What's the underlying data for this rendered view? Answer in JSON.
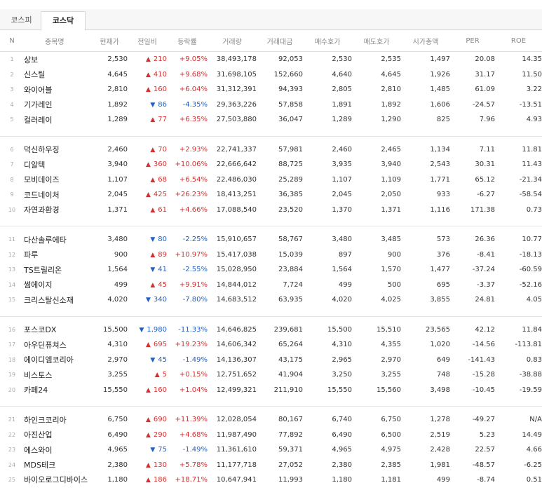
{
  "tabs": [
    {
      "label": "코스피",
      "active": false
    },
    {
      "label": "코스닥",
      "active": true
    }
  ],
  "columns": [
    "N",
    "종목명",
    "현재가",
    "전일비",
    "등락률",
    "거래량",
    "거래대금",
    "매수호가",
    "매도호가",
    "시가총액",
    "PER",
    "ROE"
  ],
  "colors": {
    "up": "#d32f2f",
    "down": "#1e5fc7"
  },
  "rows": [
    {
      "n": "1",
      "name": "상보",
      "price": "2,530",
      "dir": "up",
      "chg": "210",
      "rate": "+9.05%",
      "vol": "38,493,178",
      "amt": "92,053",
      "bid": "2,530",
      "ask": "2,535",
      "cap": "1,497",
      "per": "20.08",
      "roe": "14.35"
    },
    {
      "n": "2",
      "name": "신스틸",
      "price": "4,645",
      "dir": "up",
      "chg": "410",
      "rate": "+9.68%",
      "vol": "31,698,105",
      "amt": "152,660",
      "bid": "4,640",
      "ask": "4,645",
      "cap": "1,926",
      "per": "31.17",
      "roe": "11.50"
    },
    {
      "n": "3",
      "name": "와이어블",
      "price": "2,810",
      "dir": "up",
      "chg": "160",
      "rate": "+6.04%",
      "vol": "31,312,391",
      "amt": "94,393",
      "bid": "2,805",
      "ask": "2,810",
      "cap": "1,485",
      "per": "61.09",
      "roe": "3.22"
    },
    {
      "n": "4",
      "name": "기가레인",
      "price": "1,892",
      "dir": "down",
      "chg": "86",
      "rate": "-4.35%",
      "vol": "29,363,226",
      "amt": "57,858",
      "bid": "1,891",
      "ask": "1,892",
      "cap": "1,606",
      "per": "-24.57",
      "roe": "-13.51"
    },
    {
      "n": "5",
      "name": "컬러레이",
      "price": "1,289",
      "dir": "up",
      "chg": "77",
      "rate": "+6.35%",
      "vol": "27,503,880",
      "amt": "36,047",
      "bid": "1,289",
      "ask": "1,290",
      "cap": "825",
      "per": "7.96",
      "roe": "4.93"
    },
    {
      "n": "6",
      "name": "덕신하우징",
      "price": "2,460",
      "dir": "up",
      "chg": "70",
      "rate": "+2.93%",
      "vol": "22,741,337",
      "amt": "57,981",
      "bid": "2,460",
      "ask": "2,465",
      "cap": "1,134",
      "per": "7.11",
      "roe": "11.81"
    },
    {
      "n": "7",
      "name": "디알텍",
      "price": "3,940",
      "dir": "up",
      "chg": "360",
      "rate": "+10.06%",
      "vol": "22,666,642",
      "amt": "88,725",
      "bid": "3,935",
      "ask": "3,940",
      "cap": "2,543",
      "per": "30.31",
      "roe": "11.43"
    },
    {
      "n": "8",
      "name": "모비데이즈",
      "price": "1,107",
      "dir": "up",
      "chg": "68",
      "rate": "+6.54%",
      "vol": "22,486,030",
      "amt": "25,289",
      "bid": "1,107",
      "ask": "1,109",
      "cap": "1,771",
      "per": "65.12",
      "roe": "-21.34"
    },
    {
      "n": "9",
      "name": "코드네이처",
      "price": "2,045",
      "dir": "up",
      "chg": "425",
      "rate": "+26.23%",
      "vol": "18,413,251",
      "amt": "36,385",
      "bid": "2,045",
      "ask": "2,050",
      "cap": "933",
      "per": "-6.27",
      "roe": "-58.54"
    },
    {
      "n": "10",
      "name": "자연과환경",
      "price": "1,371",
      "dir": "up",
      "chg": "61",
      "rate": "+4.66%",
      "vol": "17,088,540",
      "amt": "23,520",
      "bid": "1,370",
      "ask": "1,371",
      "cap": "1,116",
      "per": "171.38",
      "roe": "0.73"
    },
    {
      "n": "11",
      "name": "다산솔루에타",
      "price": "3,480",
      "dir": "down",
      "chg": "80",
      "rate": "-2.25%",
      "vol": "15,910,657",
      "amt": "58,767",
      "bid": "3,480",
      "ask": "3,485",
      "cap": "573",
      "per": "26.36",
      "roe": "10.77"
    },
    {
      "n": "12",
      "name": "파루",
      "price": "900",
      "dir": "up",
      "chg": "89",
      "rate": "+10.97%",
      "vol": "15,417,038",
      "amt": "15,039",
      "bid": "897",
      "ask": "900",
      "cap": "376",
      "per": "-8.41",
      "roe": "-18.13"
    },
    {
      "n": "13",
      "name": "TS트릴리온",
      "price": "1,564",
      "dir": "down",
      "chg": "41",
      "rate": "-2.55%",
      "vol": "15,028,950",
      "amt": "23,884",
      "bid": "1,564",
      "ask": "1,570",
      "cap": "1,477",
      "per": "-37.24",
      "roe": "-60.59"
    },
    {
      "n": "14",
      "name": "썸에이지",
      "price": "499",
      "dir": "up",
      "chg": "45",
      "rate": "+9.91%",
      "vol": "14,844,012",
      "amt": "7,724",
      "bid": "499",
      "ask": "500",
      "cap": "695",
      "per": "-3.37",
      "roe": "-52.16"
    },
    {
      "n": "15",
      "name": "크리스탈신소재",
      "price": "4,020",
      "dir": "down",
      "chg": "340",
      "rate": "-7.80%",
      "vol": "14,683,512",
      "amt": "63,935",
      "bid": "4,020",
      "ask": "4,025",
      "cap": "3,855",
      "per": "24.81",
      "roe": "4.05"
    },
    {
      "n": "16",
      "name": "포스코DX",
      "price": "15,500",
      "dir": "down",
      "chg": "1,980",
      "rate": "-11.33%",
      "vol": "14,646,825",
      "amt": "239,681",
      "bid": "15,500",
      "ask": "15,510",
      "cap": "23,565",
      "per": "42.12",
      "roe": "11.84"
    },
    {
      "n": "17",
      "name": "아우딘퓨쳐스",
      "price": "4,310",
      "dir": "up",
      "chg": "695",
      "rate": "+19.23%",
      "vol": "14,606,342",
      "amt": "65,264",
      "bid": "4,310",
      "ask": "4,355",
      "cap": "1,020",
      "per": "-14.56",
      "roe": "-113.81"
    },
    {
      "n": "18",
      "name": "에이디엠코리아",
      "price": "2,970",
      "dir": "down",
      "chg": "45",
      "rate": "-1.49%",
      "vol": "14,136,307",
      "amt": "43,175",
      "bid": "2,965",
      "ask": "2,970",
      "cap": "649",
      "per": "-141.43",
      "roe": "0.83"
    },
    {
      "n": "19",
      "name": "비스토스",
      "price": "3,255",
      "dir": "up",
      "chg": "5",
      "rate": "+0.15%",
      "vol": "12,751,652",
      "amt": "41,904",
      "bid": "3,250",
      "ask": "3,255",
      "cap": "748",
      "per": "-15.28",
      "roe": "-38.88"
    },
    {
      "n": "20",
      "name": "카페24",
      "price": "15,550",
      "dir": "up",
      "chg": "160",
      "rate": "+1.04%",
      "vol": "12,499,321",
      "amt": "211,910",
      "bid": "15,550",
      "ask": "15,560",
      "cap": "3,498",
      "per": "-10.45",
      "roe": "-19.59"
    },
    {
      "n": "21",
      "name": "하인크코리아",
      "price": "6,750",
      "dir": "up",
      "chg": "690",
      "rate": "+11.39%",
      "vol": "12,028,054",
      "amt": "80,167",
      "bid": "6,740",
      "ask": "6,750",
      "cap": "1,278",
      "per": "-49.27",
      "roe": "N/A"
    },
    {
      "n": "22",
      "name": "아진산업",
      "price": "6,490",
      "dir": "up",
      "chg": "290",
      "rate": "+4.68%",
      "vol": "11,987,490",
      "amt": "77,892",
      "bid": "6,490",
      "ask": "6,500",
      "cap": "2,519",
      "per": "5.23",
      "roe": "14.49"
    },
    {
      "n": "23",
      "name": "에스와이",
      "price": "4,965",
      "dir": "down",
      "chg": "75",
      "rate": "-1.49%",
      "vol": "11,361,610",
      "amt": "59,371",
      "bid": "4,965",
      "ask": "4,975",
      "cap": "2,428",
      "per": "22.57",
      "roe": "4.66"
    },
    {
      "n": "24",
      "name": "MDS테크",
      "price": "2,380",
      "dir": "up",
      "chg": "130",
      "rate": "+5.78%",
      "vol": "11,177,718",
      "amt": "27,052",
      "bid": "2,380",
      "ask": "2,385",
      "cap": "1,981",
      "per": "-48.57",
      "roe": "-6.25"
    },
    {
      "n": "25",
      "name": "바이오로그디바이스",
      "price": "1,180",
      "dir": "up",
      "chg": "186",
      "rate": "+18.71%",
      "vol": "10,647,941",
      "amt": "11,993",
      "bid": "1,180",
      "ask": "1,181",
      "cap": "499",
      "per": "-8.74",
      "roe": "0.51"
    }
  ]
}
